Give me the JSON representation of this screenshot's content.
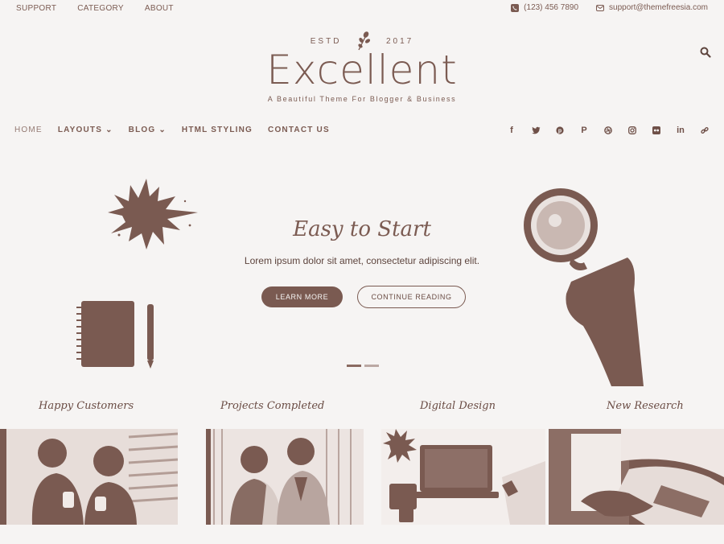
{
  "topbar": {
    "links": [
      "Support",
      "Category",
      "About"
    ],
    "phone": "(123) 456 7890",
    "email": "support@themefreesia.com"
  },
  "logo": {
    "estd_left": "ESTD",
    "estd_right": "2017",
    "title": "Excellent",
    "tagline": "A Beautiful Theme For Blogger & Business"
  },
  "nav": {
    "items": [
      "Home",
      "Layouts",
      "Blog",
      "HTML Styling",
      "Contact Us"
    ],
    "social_icons": [
      "facebook-icon",
      "twitter-icon",
      "pinterest-icon",
      "pinterest-p-icon",
      "dribbble-icon",
      "instagram-icon",
      "flickr-icon",
      "linkedin-icon",
      "link-icon"
    ]
  },
  "hero": {
    "title": "Easy to Start",
    "subtitle": "Lorem ipsum dolor sit amet, consectetur adipiscing elit.",
    "button_primary": "Learn More",
    "button_secondary": "Continue Reading",
    "slides": 2,
    "active_slide": 1
  },
  "features": [
    "Happy Customers",
    "Projects Completed",
    "Digital Design",
    "New Research"
  ],
  "colors": {
    "accent": "#7a5a51",
    "background": "#f6f4f3"
  }
}
